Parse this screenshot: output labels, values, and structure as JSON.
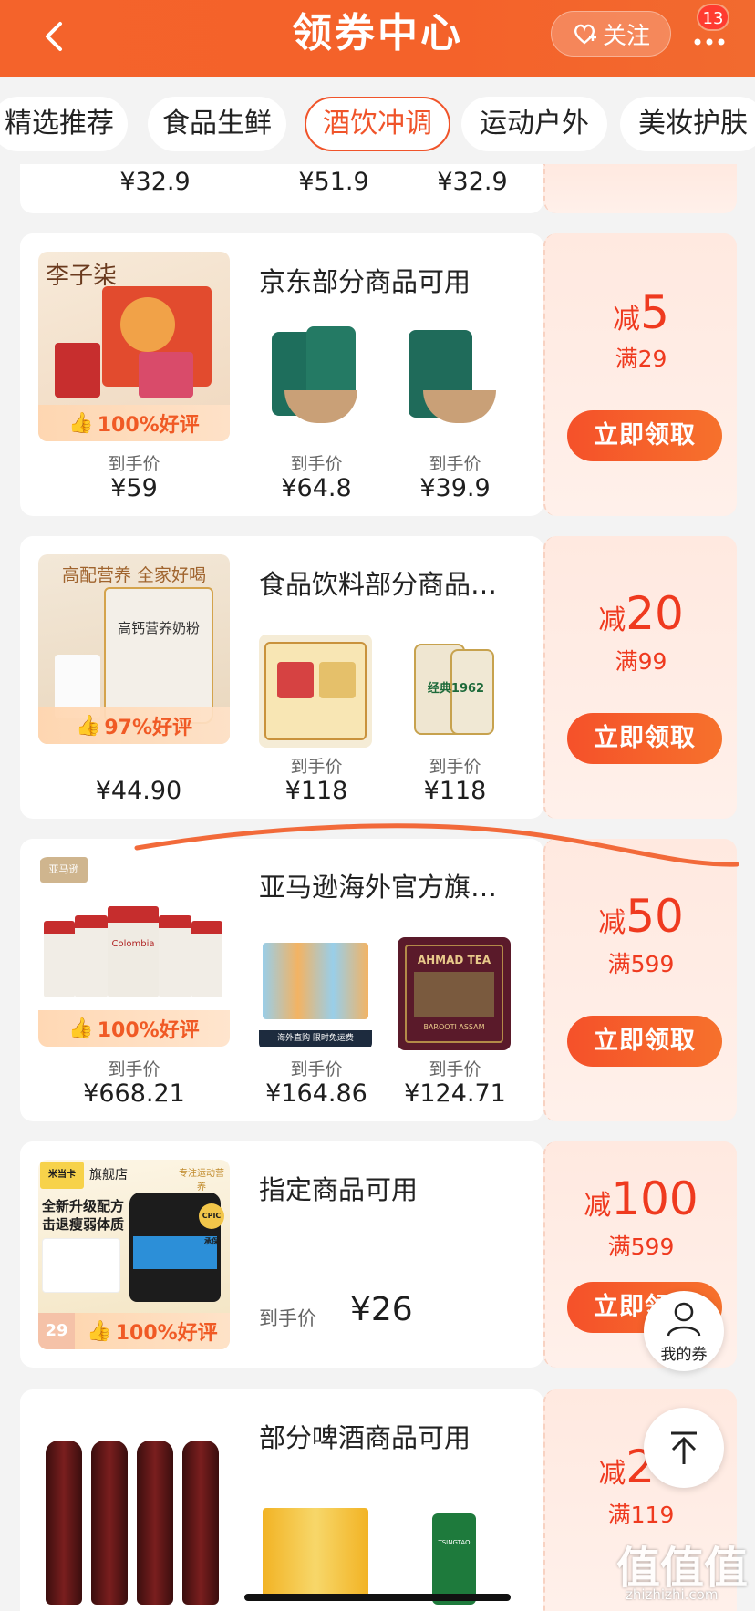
{
  "header": {
    "title": "领券中心",
    "follow_label": "关注",
    "badge_count": "13"
  },
  "tabs": [
    "精选推荐",
    "食品生鲜",
    "酒饮冲调",
    "运动户外",
    "美妆护肤"
  ],
  "active_tab": "酒饮冲调",
  "top_partial": {
    "prices": [
      "¥32.9",
      "¥51.9",
      "¥32.9"
    ]
  },
  "cards": [
    {
      "title": "京东部分商品可用",
      "main_rating": "100%好评",
      "main_brand": "李子柒",
      "price_label": "到手价",
      "prices": [
        "¥59",
        "¥64.8",
        "¥39.9"
      ],
      "coupon": {
        "prefix": "减",
        "amount": "5",
        "minimum": "满29",
        "button": "立即领取"
      }
    },
    {
      "title": "食品饮料部分商品…",
      "main_rating": "97%好评",
      "main_slogan": "高配营养 全家好喝",
      "main_product": "高钙营养奶粉",
      "price_label": "到手价",
      "prices": [
        "¥44.90",
        "¥118",
        "¥118"
      ],
      "small2_label": "经典1962",
      "coupon": {
        "prefix": "减",
        "amount": "20",
        "minimum": "满99",
        "button": "立即领取"
      }
    },
    {
      "title": "亚马逊海外官方旗…",
      "main_rating": "100%好评",
      "main_brand": "亚马逊",
      "main_product": "Colombia",
      "price_label": "到手价",
      "prices": [
        "¥668.21",
        "¥164.86",
        "¥124.71"
      ],
      "small1_tag": "海外直购 限时免运费",
      "small2_brand": "AHMAD TEA",
      "small2_sub": "BAROOTI ASSAM",
      "coupon": {
        "prefix": "减",
        "amount": "50",
        "minimum": "满599",
        "button": "立即领取"
      }
    },
    {
      "title": "指定商品可用",
      "main_rating": "100%好评",
      "main_brand": "米当卡",
      "main_shop": "旗舰店",
      "main_tag": "专注运动营养",
      "main_headline1": "全新升级配方",
      "main_headline2": "击退瘦弱体质",
      "main_badge": "CPIC承保",
      "main_price_stub": "29",
      "price_label": "到手价",
      "single_price": "¥26",
      "coupon": {
        "prefix": "减",
        "amount": "100",
        "minimum": "满599",
        "button": "立即领取"
      }
    },
    {
      "title": "部分啤酒商品可用",
      "coupon": {
        "prefix": "减",
        "amount": "20",
        "minimum": "满119"
      },
      "small2_brand": "TSINGTAO"
    }
  ],
  "floating": {
    "my_coupons": "我的券"
  },
  "watermark": {
    "text": "值值值",
    "url": "zhizhizhi.com"
  },
  "colors": {
    "brand": "#f4632b",
    "coupon_red": "#ef3a1f",
    "annotation_line": "#f26a3a"
  }
}
